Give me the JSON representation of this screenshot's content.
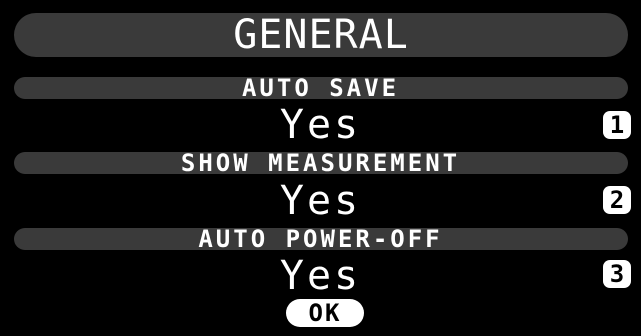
{
  "screen": {
    "title": "GENERAL"
  },
  "settings": [
    {
      "label": "AUTO SAVE",
      "value": "Yes",
      "badge": "1"
    },
    {
      "label": "SHOW MEASUREMENT",
      "value": "Yes",
      "badge": "2"
    },
    {
      "label": "AUTO POWER-OFF",
      "value": "Yes",
      "badge": "3"
    }
  ],
  "actions": {
    "ok_label": "OK"
  },
  "colors": {
    "background": "#000000",
    "bar": "#3a3a3a",
    "text": "#ffffff"
  }
}
